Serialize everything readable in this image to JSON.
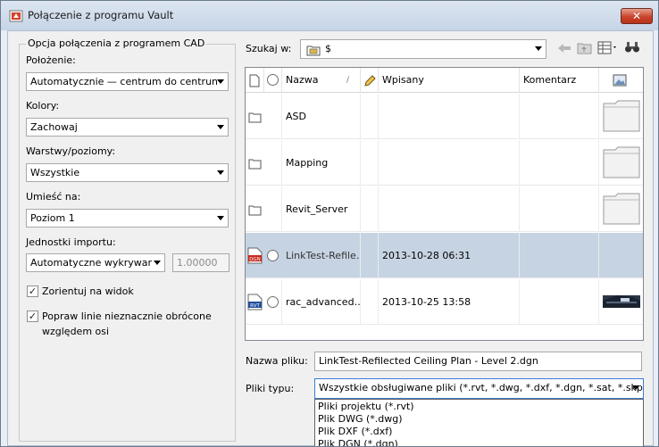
{
  "window": {
    "title": "Połączenie z programu Vault",
    "close_label": "✕"
  },
  "left": {
    "group_title": "Opcja połączenia z programem CAD",
    "fields": [
      {
        "label": "Położenie:",
        "value": "Automatycznie — centrum do centrun"
      },
      {
        "label": "Kolory:",
        "value": "Zachowaj"
      },
      {
        "label": "Warstwy/poziomy:",
        "value": "Wszystkie"
      },
      {
        "label": "Umieść na:",
        "value": "Poziom 1"
      }
    ],
    "units": {
      "label": "Jednostki importu:",
      "value": "Automatyczne wykrywar",
      "scale": "1.00000"
    },
    "checks": [
      {
        "label": "Zorientuj na widok",
        "checked": true
      },
      {
        "label": "Popraw linie nieznacznie obrócone",
        "label2": "względem osi",
        "checked": true
      }
    ]
  },
  "search": {
    "label": "Szukaj w:",
    "value": "$"
  },
  "list": {
    "columns": {
      "name": "Nazwa",
      "sort": "/",
      "checkin": "Wpisany",
      "comment": "Komentarz"
    },
    "rows": [
      {
        "name": "ASD",
        "date": "",
        "type": "folder",
        "selected": false
      },
      {
        "name": "Mapping",
        "date": "",
        "type": "folder",
        "selected": false
      },
      {
        "name": "Revit_Server",
        "date": "",
        "type": "folder",
        "selected": false
      },
      {
        "name": "LinkTest-Refile…",
        "date": "2013-10-28 06:31",
        "type": "dgn",
        "badge": "DGN",
        "selected": true
      },
      {
        "name": "rac_advanced…",
        "date": "2013-10-25 13:58",
        "type": "rvt",
        "badge": "RVT",
        "selected": false
      }
    ]
  },
  "filename": {
    "label": "Nazwa pliku:",
    "value": "LinkTest-Refilected Ceiling Plan  - Level 2.dgn"
  },
  "filetype": {
    "label": "Pliki typu:",
    "value": "Wszystkie obsługiwane pliki (*.rvt, *.dwg, *.dxf, *.dgn, *.sat, *.skp,",
    "options": [
      "Pliki projektu (*.rvt)",
      "Plik DWG (*.dwg)",
      "Plik DXF (*.dxf)",
      "Plik DGN (*.dgn)"
    ]
  },
  "colors": {
    "selection": "#c6d3e2",
    "close": "#c9442c"
  }
}
